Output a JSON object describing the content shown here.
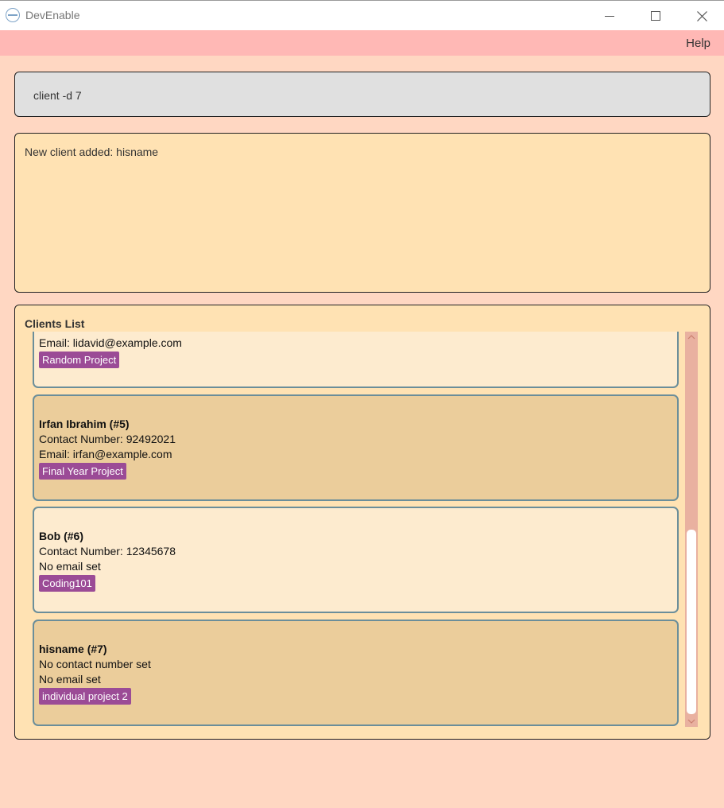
{
  "window": {
    "title": "DevEnable",
    "app_icon": "app-logo-icon",
    "controls": [
      "minimize-icon",
      "maximize-icon",
      "close-icon"
    ]
  },
  "menu": {
    "help": "Help"
  },
  "command_box": {
    "value": "client -d 7"
  },
  "result": {
    "message": "New client added: hisname"
  },
  "clients_list": {
    "title": "Clients List",
    "partial_card": {
      "email": "Email: lidavid@example.com",
      "tag": "Random Project"
    },
    "cards": [
      {
        "name": "Irfan Ibrahim (#5)",
        "contact": "Contact Number: 92492021",
        "email": "Email: irfan@example.com",
        "tag": "Final Year Project"
      },
      {
        "name": "Bob (#6)",
        "contact": "Contact Number: 12345678",
        "email": "No email set",
        "tag": "Coding101"
      },
      {
        "name": "hisname (#7)",
        "contact": "No contact number set",
        "email": "No email set",
        "tag": "individual project 2"
      }
    ]
  },
  "colors": {
    "background": "#ffd7c2",
    "menubar": "#ffb8b5",
    "command_box": "#e0e0e0",
    "result_box": "#ffe2b3",
    "card_odd": "#fdebcf",
    "card_even": "#ebcd9b",
    "tag": "#9b4b96",
    "card_border": "#6b8e9a",
    "scrollbar_track": "#e9b1a0"
  }
}
